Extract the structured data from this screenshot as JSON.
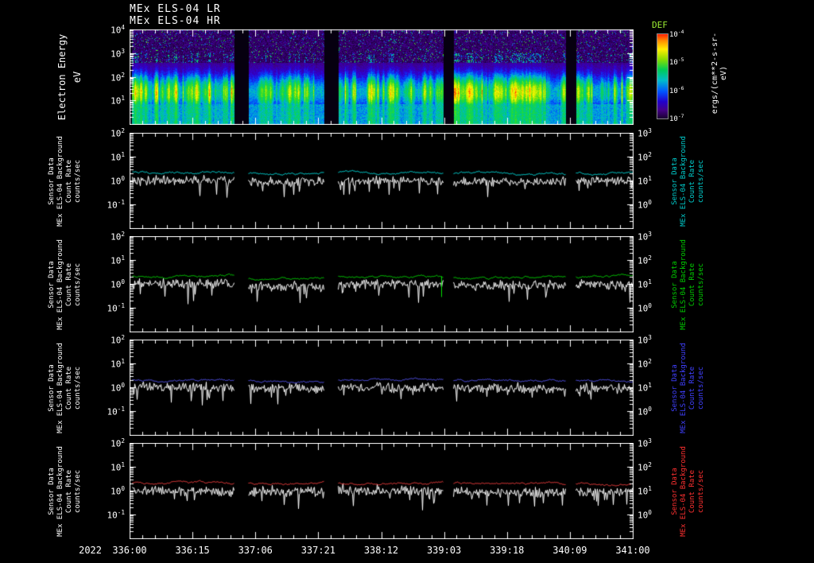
{
  "titles": {
    "line1": "MEx ELS-04 LR",
    "line2": "MEx ELS-04 HR"
  },
  "spectrogram": {
    "ylabel_block": "Electron Energy\neV"
  },
  "sensor_panel": {
    "axis_label": "Sensor Data\nMEx ELS-04 Background\nCount Rate\ncounts/sec"
  },
  "colorbar": {
    "title": "DEF",
    "title_color": "#9dee33",
    "units": "ergs/(cm**2-s-sr-eV)",
    "tick_exponents": [
      -4,
      -5,
      -6,
      -7
    ]
  },
  "time_axis": {
    "year": "2022"
  },
  "chart_data": [
    {
      "type": "heatmap",
      "title": "MEx ELS-04 LR + MEx ELS-04 HR electron energy spectrogram",
      "x_tick_labels": [
        "336:00",
        "336:15",
        "337:06",
        "337:21",
        "338:12",
        "339:03",
        "339:18",
        "340:09",
        "341:00"
      ],
      "x_axis_note": "2022 day-of-year:hour, major ticks every 15 hours",
      "ylabel": "Electron Energy",
      "y_units": "eV",
      "y_scale": "log",
      "y_range": [
        1,
        10000
      ],
      "y_tick_exponents": [
        4,
        3,
        2,
        1
      ],
      "z_label": "DEF",
      "z_units": "ergs/(cm**2-s-sr-eV)",
      "z_scale": "log",
      "z_range_exponents": [
        -7,
        -4
      ],
      "segments_frac": [
        [
          0.004,
          0.207
        ],
        [
          0.236,
          0.386
        ],
        [
          0.414,
          0.623
        ],
        [
          0.643,
          0.866
        ],
        [
          0.887,
          1.0
        ]
      ],
      "summary": "Intense band of 5-100 eV electrons with bright vertical flux enhancements reaching ~1 keV; faint speckled flux above 1 keV on a purple background; five data segments separated by black data gaps."
    },
    {
      "type": "line",
      "panel_title": "ELS-04 background count rate (cyan)",
      "label_color": "#00cccc",
      "y_units": "counts/sec",
      "y_scale": "log",
      "left_axis_exponent_range": [
        -2,
        2
      ],
      "right_axis_exponent_range": [
        -1,
        3
      ],
      "left_tick_exponents": [
        2,
        1,
        0,
        -1
      ],
      "right_tick_exponents": [
        3,
        2,
        1,
        0
      ],
      "series": [
        {
          "name": "count rate",
          "color": "#ffffff",
          "axis": "left",
          "style": "noisy",
          "segment_mean_levels": [
            1.0,
            0.85,
            1.0,
            0.9,
            0.95
          ]
        },
        {
          "name": "background",
          "color": "#00e8e8",
          "axis": "right",
          "style": "smooth",
          "segment_mean_levels": [
            22,
            19,
            21,
            20,
            20
          ]
        }
      ]
    },
    {
      "type": "line",
      "panel_title": "ELS-04 background count rate (green)",
      "label_color": "#00cc00",
      "y_units": "counts/sec",
      "y_scale": "log",
      "left_axis_exponent_range": [
        -2,
        2
      ],
      "right_axis_exponent_range": [
        -1,
        3
      ],
      "left_tick_exponents": [
        2,
        1,
        0,
        -1
      ],
      "right_tick_exponents": [
        3,
        2,
        1,
        0
      ],
      "series": [
        {
          "name": "count rate",
          "color": "#ffffff",
          "axis": "left",
          "style": "noisy",
          "segment_mean_levels": [
            1.0,
            0.8,
            0.95,
            0.85,
            0.95
          ]
        },
        {
          "name": "background",
          "color": "#00e000",
          "axis": "right",
          "style": "smooth",
          "segment_mean_levels": [
            21,
            17,
            20,
            19,
            20
          ],
          "spike": {
            "x_frac": 0.62,
            "depth_decades": 0.85
          }
        }
      ]
    },
    {
      "type": "line",
      "panel_title": "ELS-04 background count rate (blue)",
      "label_color": "#4040ff",
      "y_units": "counts/sec",
      "y_scale": "log",
      "left_axis_exponent_range": [
        -2,
        2
      ],
      "right_axis_exponent_range": [
        -1,
        3
      ],
      "left_tick_exponents": [
        2,
        1,
        0,
        -1
      ],
      "right_tick_exponents": [
        3,
        2,
        1,
        0
      ],
      "series": [
        {
          "name": "count rate",
          "color": "#ffffff",
          "axis": "left",
          "style": "noisy",
          "segment_mean_levels": [
            1.0,
            0.9,
            0.95,
            0.9,
            0.9
          ]
        },
        {
          "name": "background",
          "color": "#5858ff",
          "axis": "right",
          "style": "smooth",
          "segment_mean_levels": [
            20,
            18,
            20,
            19,
            19
          ]
        }
      ]
    },
    {
      "type": "line",
      "panel_title": "ELS-04 background count rate (red)",
      "label_color": "#ff3030",
      "y_units": "counts/sec",
      "y_scale": "log",
      "left_axis_exponent_range": [
        -2,
        2
      ],
      "right_axis_exponent_range": [
        -1,
        3
      ],
      "left_tick_exponents": [
        2,
        1,
        0,
        -1
      ],
      "right_tick_exponents": [
        3,
        2,
        1,
        0
      ],
      "series": [
        {
          "name": "count rate",
          "color": "#ffffff",
          "axis": "left",
          "style": "noisy",
          "segment_mean_levels": [
            0.95,
            0.9,
            1.0,
            0.85,
            0.9
          ]
        },
        {
          "name": "background",
          "color": "#ff4040",
          "axis": "right",
          "style": "smooth",
          "segment_mean_levels": [
            22,
            20,
            21,
            20,
            20
          ]
        }
      ]
    }
  ]
}
